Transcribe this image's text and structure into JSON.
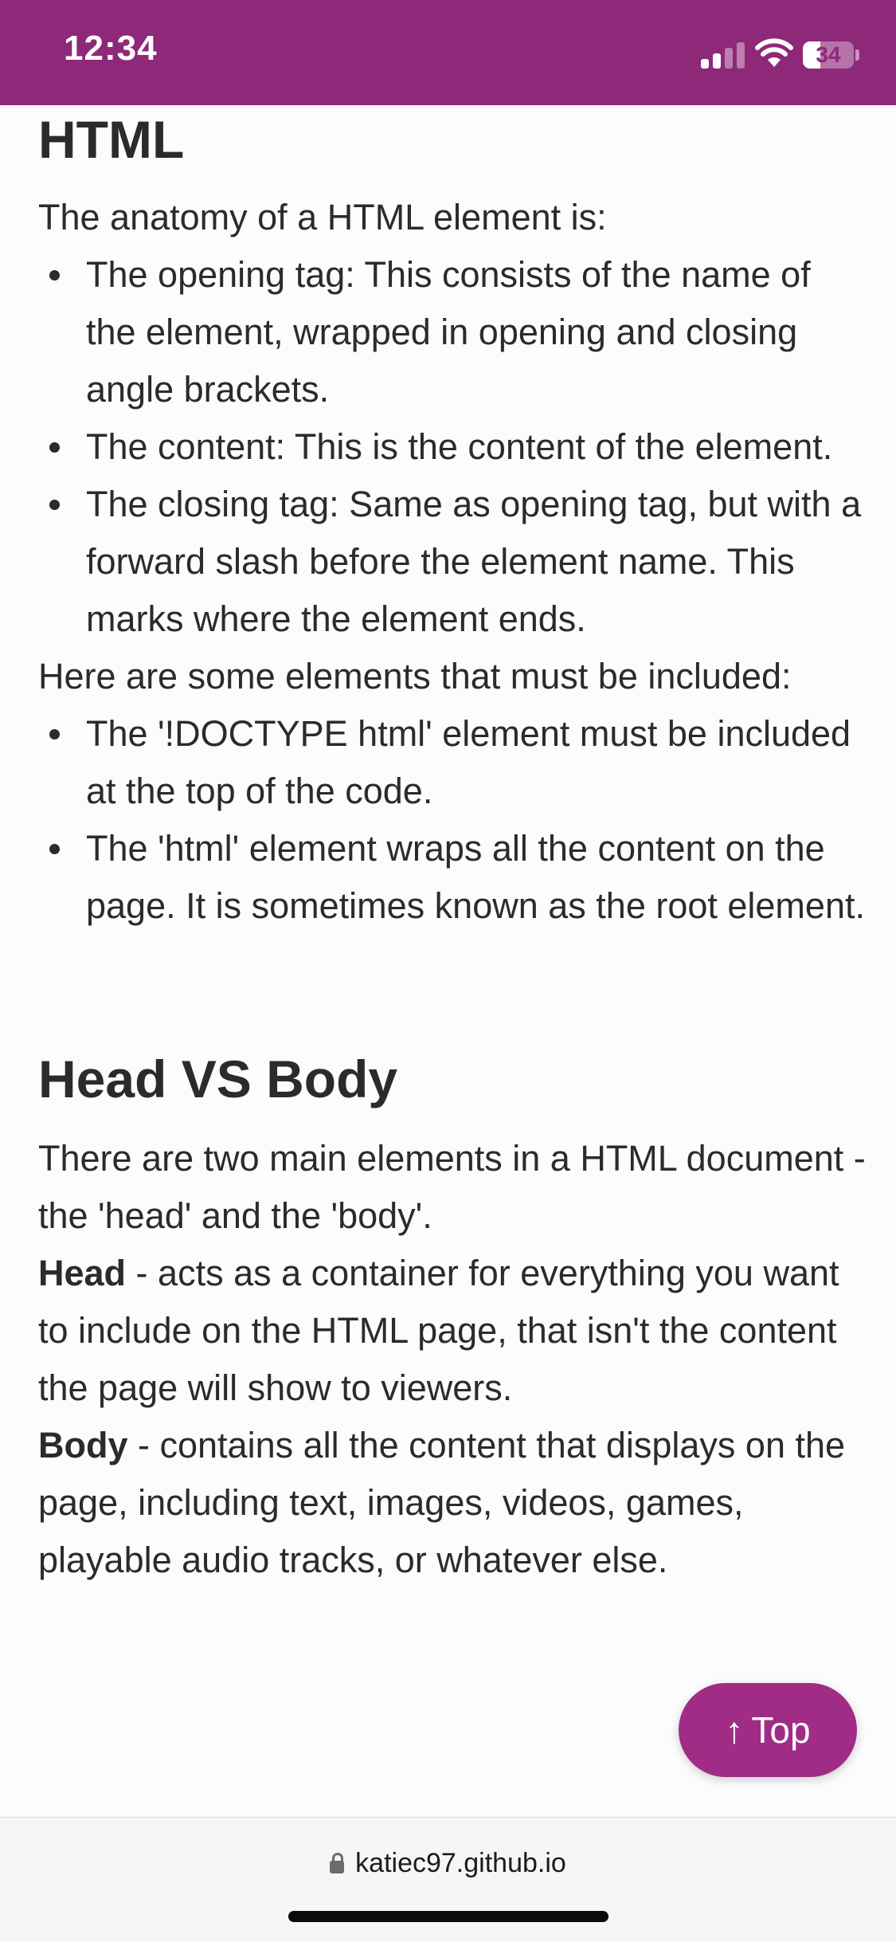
{
  "status_bar": {
    "time": "12:34",
    "battery_level": "34",
    "background_color": "#8e2878",
    "icons": [
      "signal-icon",
      "wifi-icon",
      "battery-icon"
    ]
  },
  "section_html": {
    "title": "HTML",
    "intro": "The anatomy of a HTML element is:",
    "anatomy_items": [
      "The opening tag: This consists of the name of the element, wrapped in opening and closing angle brackets.",
      "The content: This is the content of the element.",
      "The closing tag: Same as opening tag, but with a forward slash before the element name. This marks where the element ends."
    ],
    "required_intro": "Here are some elements that must be included:",
    "required_items": [
      "The '!DOCTYPE html' element must be included at the top of the code.",
      "The 'html' element wraps all the content on the page. It is sometimes known as the root element."
    ]
  },
  "section_head_body": {
    "title": "Head VS Body",
    "intro": "There are two main elements in a HTML document - the 'head' and the 'body'.",
    "head_term": "Head",
    "head_desc": " - acts as a container for everything you want to include on the HTML page, that isn't the content the page will show to viewers.",
    "body_term": "Body",
    "body_desc": " - contains all the content that displays on the page, including text, images, videos, games, playable audio tracks, or whatever else."
  },
  "top_button": {
    "arrow": "↑",
    "label": "Top",
    "color": "#a02c86"
  },
  "url_bar": {
    "url": "katiec97.github.io"
  }
}
